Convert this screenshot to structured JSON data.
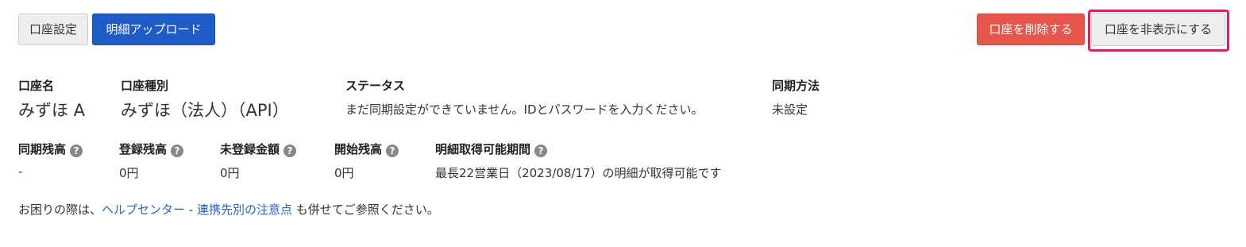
{
  "toolbar": {
    "account_settings_label": "口座設定",
    "upload_statement_label": "明細アップロード",
    "delete_account_label": "口座を削除する",
    "hide_account_label": "口座を非表示にする"
  },
  "account": {
    "name_label": "口座名",
    "name_value": "みずほ A",
    "type_label": "口座種別",
    "type_value": "みずほ（法人）（API）",
    "status_label": "ステータス",
    "status_value": "まだ同期設定ができていません。IDとパスワードを入力ください。",
    "sync_method_label": "同期方法",
    "sync_method_value": "未設定"
  },
  "balances": {
    "synced_label": "同期残高",
    "synced_value": "-",
    "registered_label": "登録残高",
    "registered_value": "0円",
    "unregistered_label": "未登録金額",
    "unregistered_value": "0円",
    "opening_label": "開始残高",
    "opening_value": "0円",
    "period_label": "明細取得可能期間",
    "period_value": "最長22営業日（2023/08/17）の明細が取得可能です",
    "help_glyph": "?"
  },
  "footer": {
    "prefix": "お困りの際は、",
    "help_center_link": "ヘルプセンター",
    "separator": " - ",
    "notes_link": "連携先別の注意点",
    "suffix": " も併せてご参照ください。"
  },
  "colors": {
    "primary": "#1f5cc8",
    "danger": "#e6564c",
    "highlight": "#e8195e",
    "link": "#2a63c9"
  }
}
